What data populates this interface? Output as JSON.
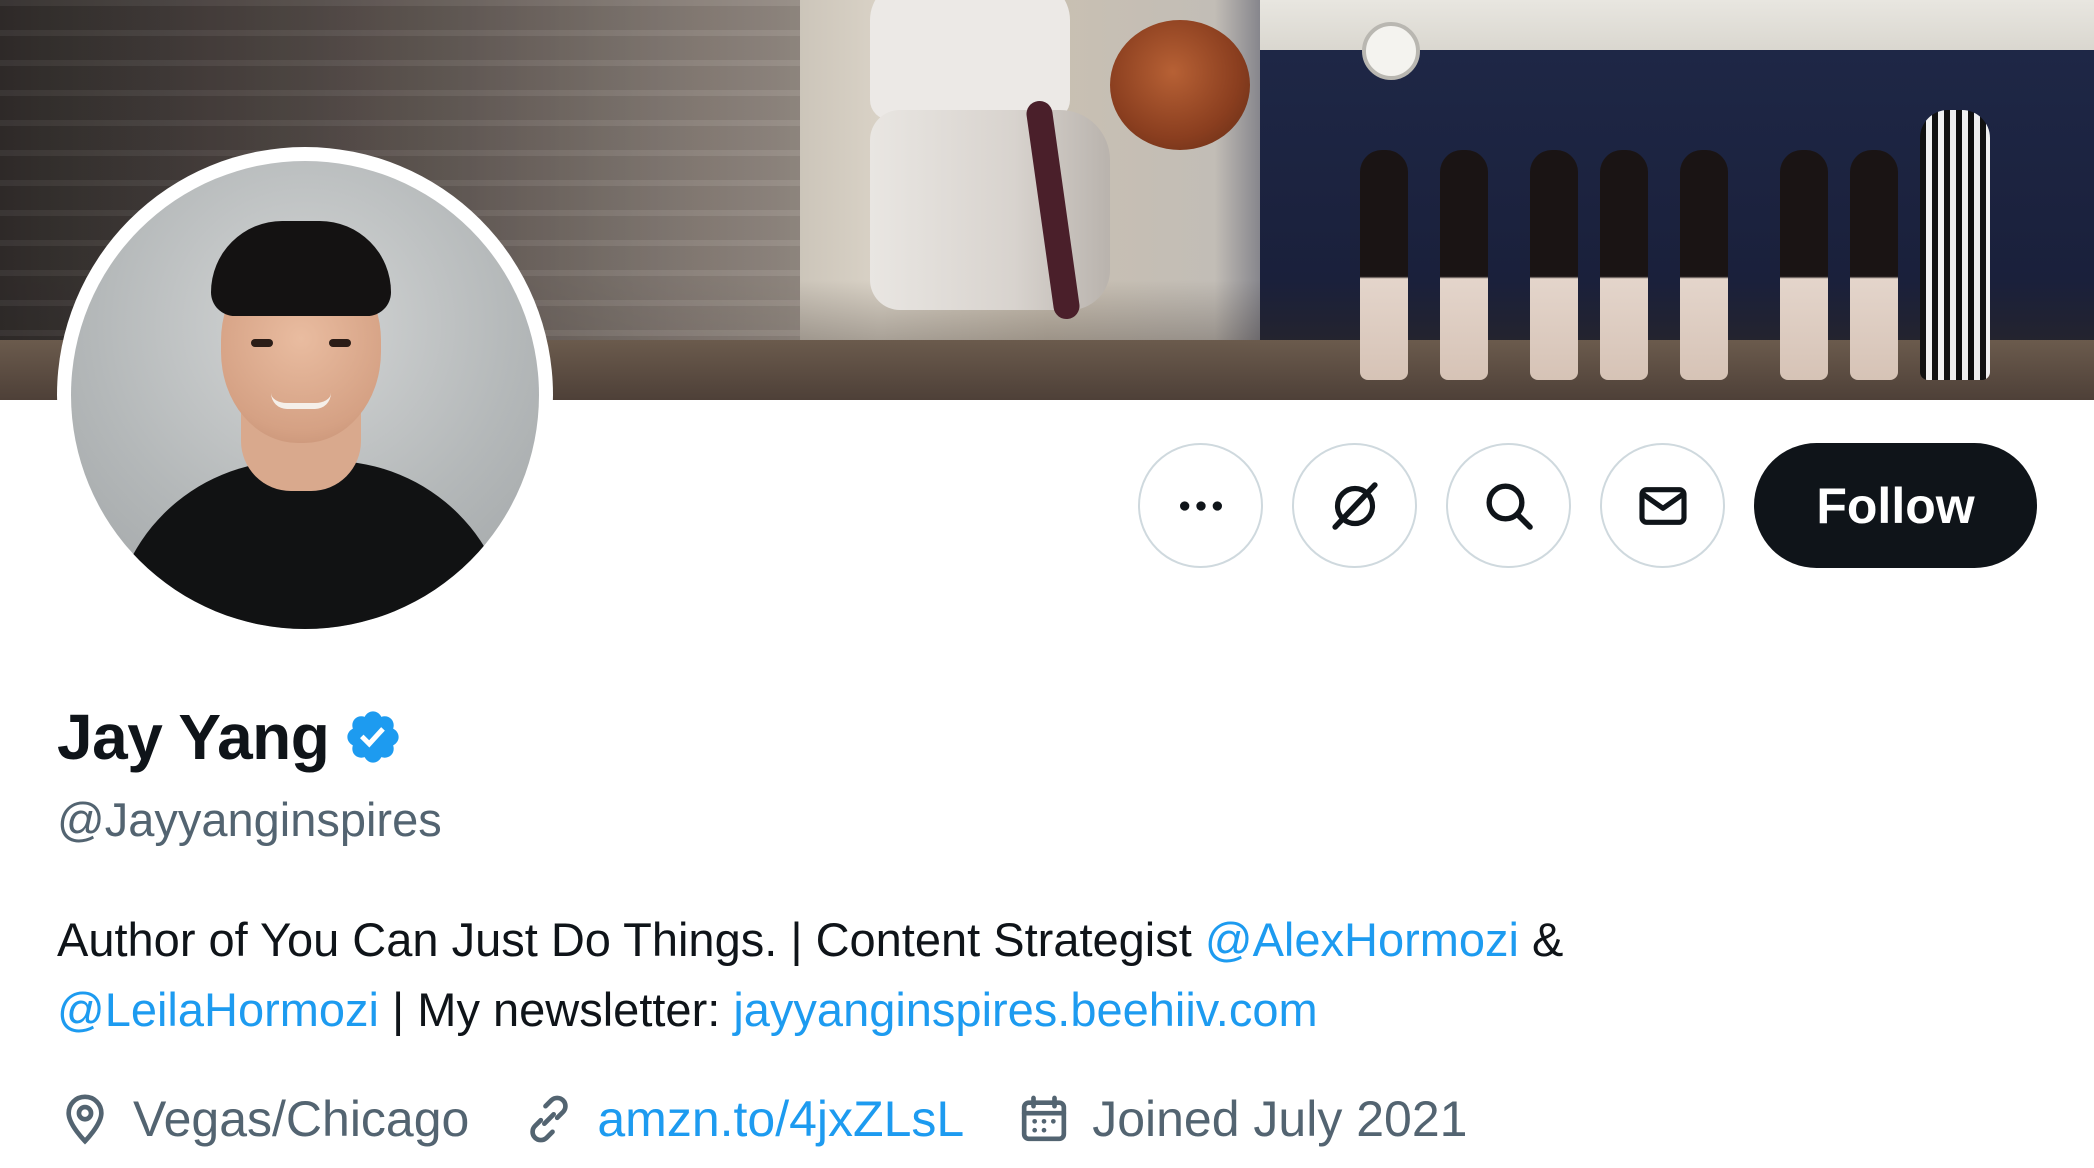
{
  "profile": {
    "display_name": "Jay Yang",
    "verified_icon": "verified-badge-icon",
    "handle": "@Jayyanginspires",
    "bio": {
      "part1": "Author of You Can Just Do Things. | Content Strategist ",
      "mention1": "@AlexHormozi",
      "part2": " & ",
      "mention2": "@LeilaHormozi",
      "part3": " | My newsletter: ",
      "link": "jayyanginspires.beehiiv.com"
    },
    "location": "Vegas/Chicago",
    "website": "amzn.to/4jxZLsL",
    "joined": "Joined July 2021"
  },
  "actions": {
    "more_icon": "more-icon",
    "grok_icon": "grok-icon",
    "search_icon": "search-icon",
    "message_icon": "mail-icon",
    "follow_label": "Follow"
  },
  "colors": {
    "accent": "#1d9bf0",
    "text_primary": "#0f1419",
    "text_secondary": "#536471",
    "border": "#cfd9de",
    "follow_bg": "#0f1419"
  }
}
